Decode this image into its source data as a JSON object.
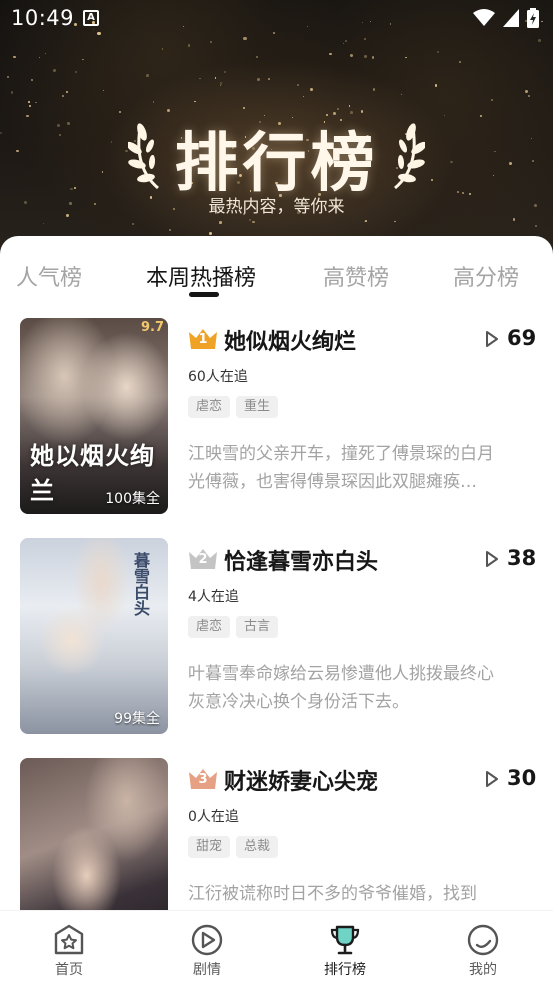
{
  "status_bar": {
    "time": "10:49",
    "notification_icon": "A"
  },
  "hero": {
    "title": "排行榜",
    "subtitle": "最热内容，等你来"
  },
  "tabs": [
    {
      "label": "人气榜",
      "active": false
    },
    {
      "label": "本周热播榜",
      "active": true
    },
    {
      "label": "高赞榜",
      "active": false
    },
    {
      "label": "高分榜",
      "active": false
    }
  ],
  "items": [
    {
      "rank": "1",
      "rank_color": "#f0a227",
      "title": "她似烟火绚烂",
      "play_count": "69",
      "followers": "60人在追",
      "tags": [
        "虐恋",
        "重生"
      ],
      "description": "江映雪的父亲开车，撞死了傅景琛的白月光傅薇，也害得傅景琛因此双腿瘫痪…",
      "poster_score": "9.7",
      "poster_episodes": "100集全",
      "poster_art_title": "她以烟火绚兰"
    },
    {
      "rank": "2",
      "rank_color": "#c4c4c4",
      "title": "恰逢暮雪亦白头",
      "play_count": "38",
      "followers": "4人在追",
      "tags": [
        "虐恋",
        "古言"
      ],
      "description": "叶暮雪奉命嫁给云易惨遭他人挑拨最终心灰意冷决心换个身份活下去。",
      "poster_episodes": "99集全",
      "poster_art_title": "暮雪白头"
    },
    {
      "rank": "3",
      "rank_color": "#e6a083",
      "title": "财迷娇妻心尖宠",
      "play_count": "30",
      "followers": "0人在追",
      "tags": [
        "甜宠",
        "总裁"
      ],
      "description": "江衍被谎称时日不多的爷爷催婚，找到"
    }
  ],
  "bottom_nav": [
    {
      "label": "首页",
      "icon": "home-star-icon",
      "active": false
    },
    {
      "label": "剧情",
      "icon": "play-circle-icon",
      "active": false
    },
    {
      "label": "排行榜",
      "icon": "trophy-icon",
      "active": true
    },
    {
      "label": "我的",
      "icon": "profile-smile-icon",
      "active": false
    }
  ]
}
